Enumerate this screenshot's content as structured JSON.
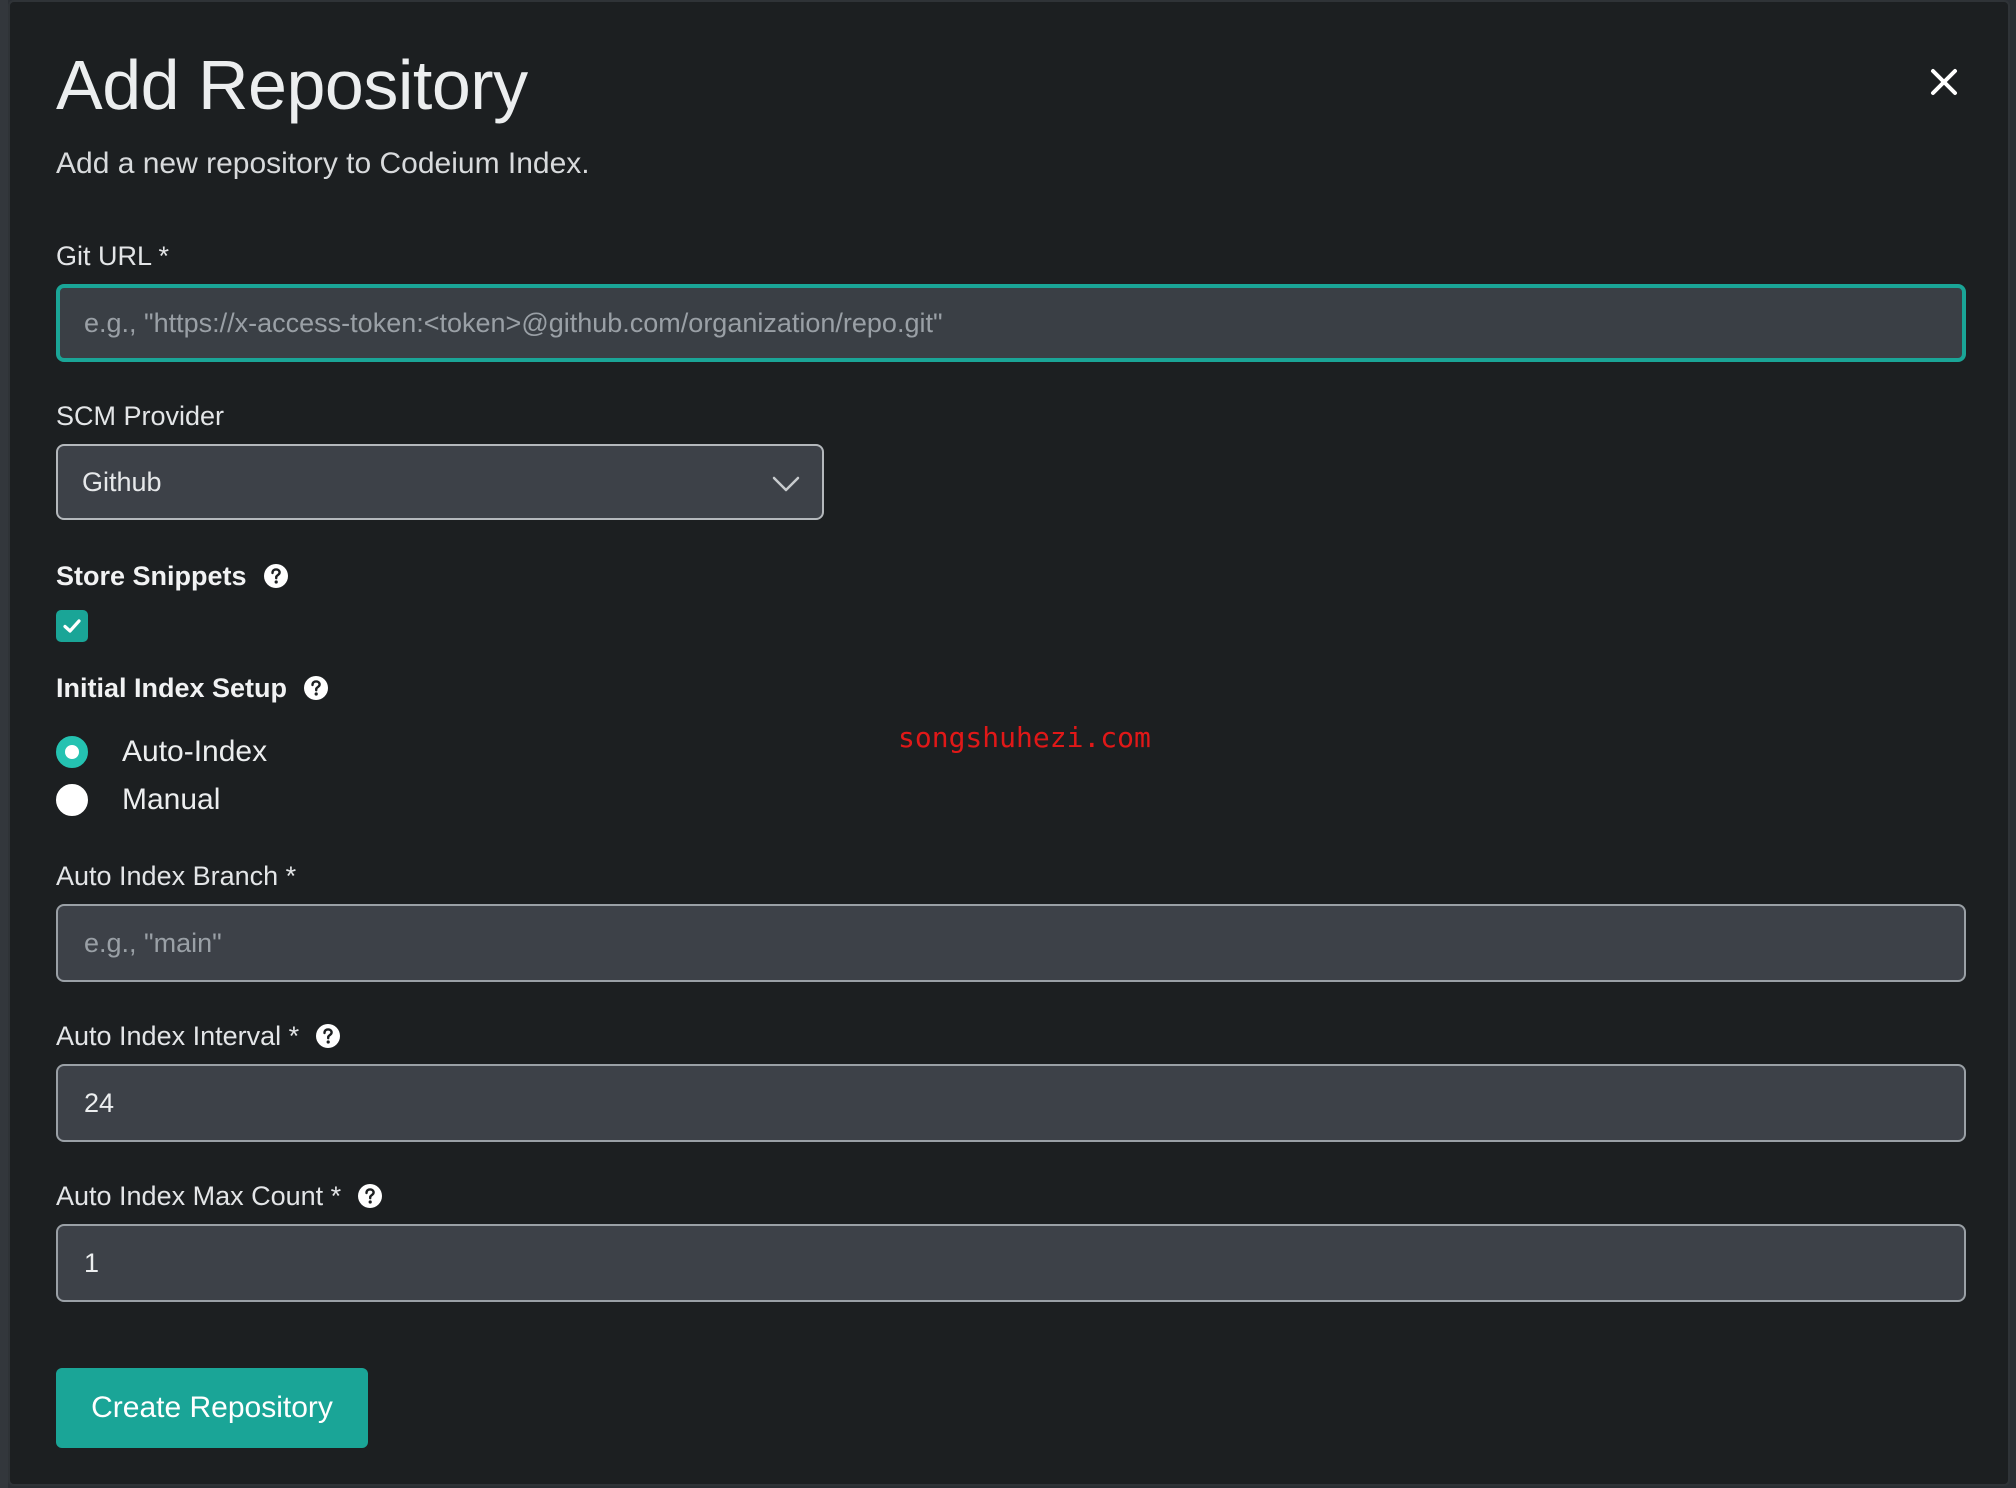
{
  "dialog": {
    "title": "Add Repository",
    "subtitle": "Add a new repository to Codeium Index.",
    "close_icon": "close-icon"
  },
  "form": {
    "git_url": {
      "label": "Git URL *",
      "placeholder": "e.g., \"https://x-access-token:<token>@github.com/organization/repo.git\"",
      "value": ""
    },
    "scm_provider": {
      "label": "SCM Provider",
      "selected": "Github",
      "icon": "chevron-down-icon"
    },
    "store_snippets": {
      "label": "Store Snippets",
      "checked": true,
      "help_icon": "question-circle-icon"
    },
    "initial_index_setup": {
      "label": "Initial Index Setup",
      "help_icon": "question-circle-icon",
      "options": [
        "Auto-Index",
        "Manual"
      ],
      "selected": "Auto-Index"
    },
    "auto_index_branch": {
      "label": "Auto Index Branch *",
      "placeholder": "e.g., \"main\"",
      "value": ""
    },
    "auto_index_interval": {
      "label": "Auto Index Interval *",
      "value": "24",
      "help_icon": "question-circle-icon"
    },
    "auto_index_max_count": {
      "label": "Auto Index Max Count *",
      "value": "1",
      "help_icon": "question-circle-icon"
    },
    "submit_label": "Create Repository"
  },
  "watermark": "songshuhezi.com",
  "colors": {
    "accent": "#1aa597",
    "radio_accent": "#24c2b1",
    "background": "#1c1f21",
    "input_background": "#3d4148",
    "watermark": "#e01818"
  }
}
